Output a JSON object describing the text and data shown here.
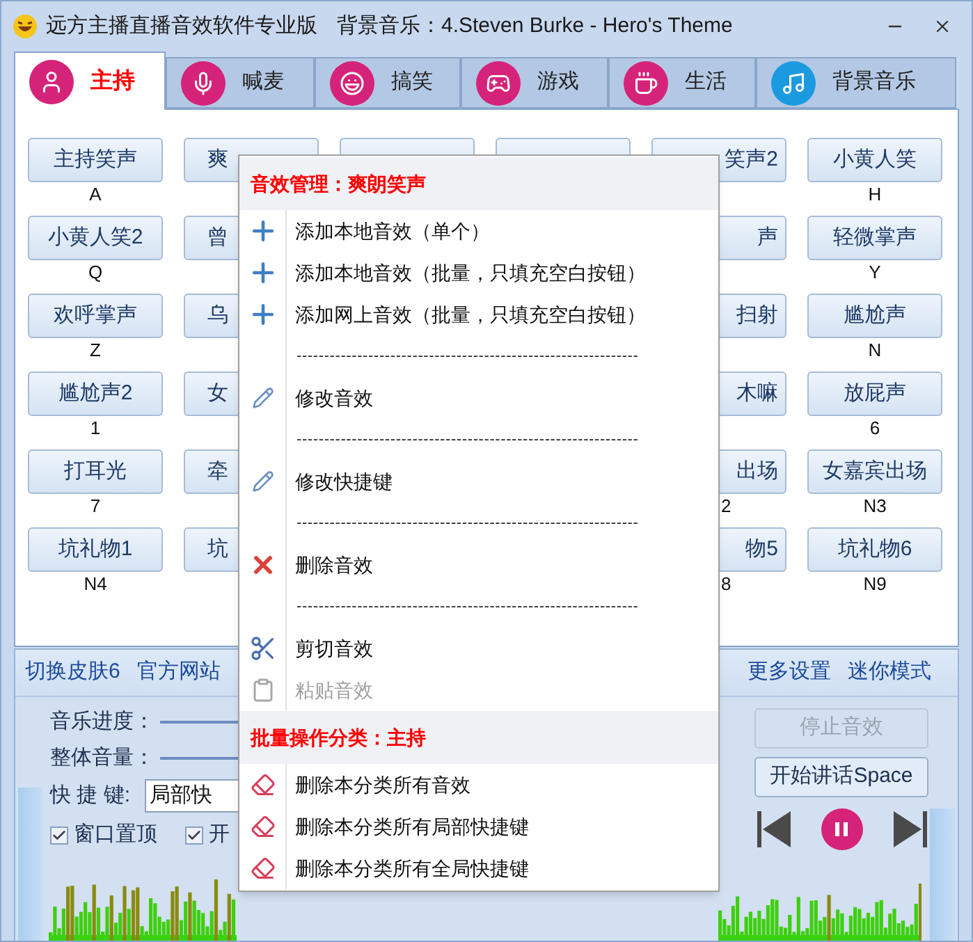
{
  "window": {
    "title": "远方主播直播音效软件专业版",
    "now_playing": "背景音乐：4.Steven Burke - Hero's Theme"
  },
  "tabs": [
    {
      "label": "主持",
      "selected": true,
      "color": "#d6237a"
    },
    {
      "label": "喊麦",
      "selected": false,
      "color": "#d6237a"
    },
    {
      "label": "搞笑",
      "selected": false,
      "color": "#d6237a"
    },
    {
      "label": "游戏",
      "selected": false,
      "color": "#d6237a"
    },
    {
      "label": "生活",
      "selected": false,
      "color": "#d6237a"
    },
    {
      "label": "背景音乐",
      "selected": false,
      "color": "#1c9ae0"
    }
  ],
  "sound_buttons": [
    [
      {
        "label": "主持笑声",
        "key": "A"
      },
      {
        "label": "爽"
      },
      {
        "label": "笑声2"
      },
      {
        "label": "小黄人笑",
        "key": "H"
      }
    ],
    [
      {
        "label": "小黄人笑2",
        "key": "Q"
      },
      {
        "label": "曾"
      },
      {
        "label": "声"
      },
      {
        "label": "轻微掌声",
        "key": "Y"
      }
    ],
    [
      {
        "label": "欢呼掌声",
        "key": "Z"
      },
      {
        "label": "乌"
      },
      {
        "label": "扫射"
      },
      {
        "label": "尴尬声",
        "key": "N"
      }
    ],
    [
      {
        "label": "尴尬声2",
        "key": "1"
      },
      {
        "label": "女"
      },
      {
        "label": "木嘛"
      },
      {
        "label": "放屁声",
        "key": "6"
      }
    ],
    [
      {
        "label": "打耳光",
        "key": "7"
      },
      {
        "label": "牵"
      },
      {
        "label": "出场",
        "key": "2"
      },
      {
        "label": "女嘉宾出场",
        "key": "N3"
      }
    ],
    [
      {
        "label": "坑礼物1",
        "key": "N4"
      },
      {
        "label": "坑"
      },
      {
        "label": "物5",
        "key": "8"
      },
      {
        "label": "坑礼物6",
        "key": "N9"
      }
    ]
  ],
  "links_left": [
    "切换皮肤6",
    "官方网站"
  ],
  "links_right": [
    "更多设置",
    "迷你模式"
  ],
  "controls": {
    "progress_label": "音乐进度：",
    "volume_label": "整体音量：",
    "hotkey_label": "快 捷 键:",
    "hotkey_value": "局部快",
    "checkboxes": [
      {
        "label": "窗口置顶",
        "checked": true
      },
      {
        "label": "开",
        "checked": true
      }
    ],
    "stop_button": {
      "label": "停止音效",
      "disabled": true
    },
    "talk_button": {
      "label": "开始讲话Space",
      "disabled": false
    }
  },
  "context_menu": [
    {
      "kind": "header",
      "text": "音效管理：爽朗笑声"
    },
    {
      "kind": "add",
      "text": "添加本地音效（单个）",
      "disabled": false
    },
    {
      "kind": "add",
      "text": "添加本地音效（批量，只填充空白按钮）",
      "disabled": false
    },
    {
      "kind": "add",
      "text": "添加网上音效（批量，只填充空白按钮）",
      "disabled": false
    },
    {
      "kind": "dashes",
      "text": "--------------------------------------------------------------"
    },
    {
      "kind": "edit",
      "text": "修改音效",
      "disabled": false
    },
    {
      "kind": "dashes",
      "text": "--------------------------------------------------------------"
    },
    {
      "kind": "edit",
      "text": "修改快捷键",
      "disabled": false
    },
    {
      "kind": "dashes",
      "text": "--------------------------------------------------------------"
    },
    {
      "kind": "delete",
      "text": "删除音效",
      "disabled": false
    },
    {
      "kind": "dashes",
      "text": "--------------------------------------------------------------"
    },
    {
      "kind": "cut",
      "text": "剪切音效",
      "disabled": false
    },
    {
      "kind": "paste",
      "text": "粘贴音效",
      "disabled": true
    },
    {
      "kind": "header",
      "text": "批量操作分类：主持"
    },
    {
      "kind": "erase",
      "text": "删除本分类所有音效",
      "disabled": false
    },
    {
      "kind": "erase",
      "text": "删除本分类所有局部快捷键",
      "disabled": false
    },
    {
      "kind": "erase",
      "text": "删除本分类所有全局快捷键",
      "disabled": false
    }
  ]
}
